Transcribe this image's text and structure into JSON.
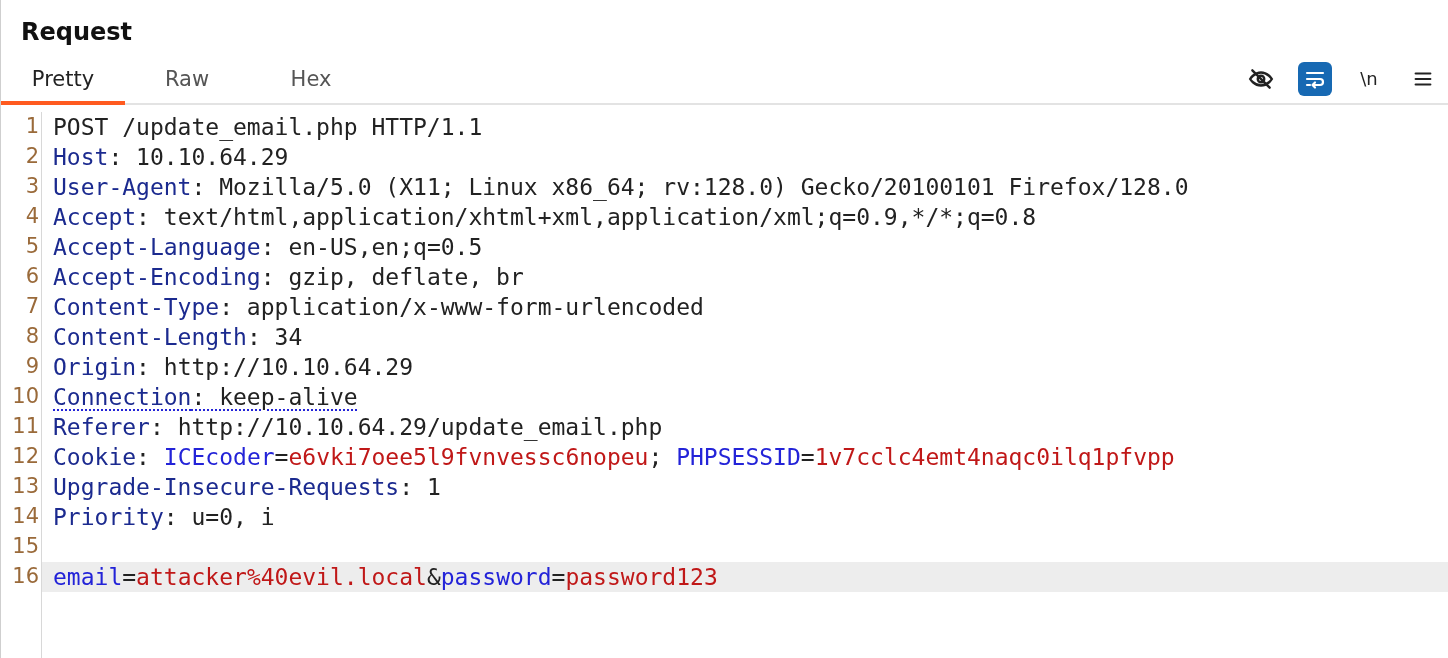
{
  "title": "Request",
  "tabs": [
    {
      "label": "Pretty",
      "selected": true
    },
    {
      "label": "Raw",
      "selected": false
    },
    {
      "label": "Hex",
      "selected": false
    }
  ],
  "toolbar": [
    {
      "kind": "hide",
      "on": false
    },
    {
      "kind": "wrap",
      "on": true
    },
    {
      "kind": "newline",
      "label": "\\n",
      "on": false
    },
    {
      "kind": "menu"
    }
  ],
  "lines": [
    {
      "number": "1",
      "current": false,
      "flagged": false,
      "segments": [
        {
          "kind": "plain",
          "text": "POST /update_email.php HTTP/1.1"
        }
      ]
    },
    {
      "number": "2",
      "current": false,
      "flagged": false,
      "segments": [
        {
          "kind": "header",
          "text": "Host"
        },
        {
          "kind": "plain",
          "text": ": 10.10.64.29"
        }
      ]
    },
    {
      "number": "3",
      "current": false,
      "flagged": false,
      "segments": [
        {
          "kind": "header",
          "text": "User-Agent"
        },
        {
          "kind": "plain",
          "text": ": Mozilla/5.0 (X11; Linux x86_64; rv:128.0) Gecko/20100101 Firefox/128.0"
        }
      ]
    },
    {
      "number": "4",
      "current": false,
      "flagged": false,
      "segments": [
        {
          "kind": "header",
          "text": "Accept"
        },
        {
          "kind": "plain",
          "text": ": text/html,application/xhtml+xml,application/xml;q=0.9,*/*;q=0.8"
        }
      ]
    },
    {
      "number": "5",
      "current": false,
      "flagged": false,
      "segments": [
        {
          "kind": "header",
          "text": "Accept-Language"
        },
        {
          "kind": "plain",
          "text": ": en-US,en;q=0.5"
        }
      ]
    },
    {
      "number": "6",
      "current": false,
      "flagged": false,
      "segments": [
        {
          "kind": "header",
          "text": "Accept-Encoding"
        },
        {
          "kind": "plain",
          "text": ": gzip, deflate, br"
        }
      ]
    },
    {
      "number": "7",
      "current": false,
      "flagged": false,
      "segments": [
        {
          "kind": "header",
          "text": "Content-Type"
        },
        {
          "kind": "plain",
          "text": ": application/x-www-form-urlencoded"
        }
      ]
    },
    {
      "number": "8",
      "current": false,
      "flagged": false,
      "segments": [
        {
          "kind": "header",
          "text": "Content-Length"
        },
        {
          "kind": "plain",
          "text": ": 34"
        }
      ]
    },
    {
      "number": "9",
      "current": false,
      "flagged": false,
      "segments": [
        {
          "kind": "header",
          "text": "Origin"
        },
        {
          "kind": "plain",
          "text": ": http://10.10.64.29"
        }
      ]
    },
    {
      "number": "10",
      "current": false,
      "flagged": true,
      "segments": [
        {
          "kind": "header",
          "text": "Connection"
        },
        {
          "kind": "plain",
          "text": ": keep-alive"
        }
      ]
    },
    {
      "number": "11",
      "current": false,
      "flagged": false,
      "segments": [
        {
          "kind": "header",
          "text": "Referer"
        },
        {
          "kind": "plain",
          "text": ": http://10.10.64.29/update_email.php"
        }
      ]
    },
    {
      "number": "12",
      "current": false,
      "flagged": false,
      "segments": [
        {
          "kind": "header",
          "text": "Cookie"
        },
        {
          "kind": "plain",
          "text": ": "
        },
        {
          "kind": "name",
          "text": "ICEcoder"
        },
        {
          "kind": "plain",
          "text": "="
        },
        {
          "kind": "value",
          "text": "e6vki7oee5l9fvnvessc6nopeu"
        },
        {
          "kind": "plain",
          "text": "; "
        },
        {
          "kind": "name",
          "text": "PHPSESSID"
        },
        {
          "kind": "plain",
          "text": "="
        },
        {
          "kind": "value",
          "text": "1v7cclc4emt4naqc0ilq1pfvpp"
        }
      ]
    },
    {
      "number": "13",
      "current": false,
      "flagged": false,
      "segments": [
        {
          "kind": "header",
          "text": "Upgrade-Insecure-Requests"
        },
        {
          "kind": "plain",
          "text": ": 1"
        }
      ]
    },
    {
      "number": "14",
      "current": false,
      "flagged": false,
      "segments": [
        {
          "kind": "header",
          "text": "Priority"
        },
        {
          "kind": "plain",
          "text": ": u=0, i"
        }
      ]
    },
    {
      "number": "15",
      "current": false,
      "flagged": false
    },
    {
      "number": "16",
      "current": true,
      "flagged": false,
      "segments": [
        {
          "kind": "name",
          "text": "email"
        },
        {
          "kind": "plain",
          "text": "="
        },
        {
          "kind": "value",
          "text": "attacker%40evil.local"
        },
        {
          "kind": "plain",
          "text": "&"
        },
        {
          "kind": "name",
          "text": "password"
        },
        {
          "kind": "plain",
          "text": "="
        },
        {
          "kind": "value",
          "text": "password123"
        }
      ]
    }
  ]
}
